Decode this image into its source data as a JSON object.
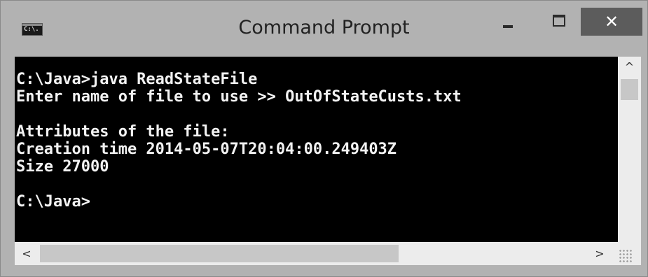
{
  "window": {
    "title": "Command Prompt",
    "icon_label": "C:\\.",
    "close_glyph": "✕",
    "up_glyph": "^",
    "down_glyph": "⌄",
    "left_glyph": "<",
    "right_glyph": ">",
    "icons": {
      "app": "console-icon",
      "minimize": "minimize-icon",
      "maximize": "maximize-icon",
      "close": "close-icon",
      "scroll_up": "chevron-up-icon",
      "scroll_down": "chevron-down-icon",
      "scroll_left": "chevron-left-icon",
      "scroll_right": "chevron-right-icon",
      "resize_grip": "resize-grip-icon"
    },
    "colors": {
      "console_bg": "#000000",
      "console_text": "#f2f2f2",
      "frame": "#b2b2b2",
      "close_button": "#5c5c5c"
    }
  },
  "console": {
    "lines": [
      "C:\\Java>java ReadStateFile",
      "Enter name of file to use >> OutOfStateCusts.txt",
      "",
      "Attributes of the file:",
      "Creation time 2014-05-07T20:04:00.249403Z",
      "Size 27000",
      "",
      "C:\\Java>"
    ]
  }
}
